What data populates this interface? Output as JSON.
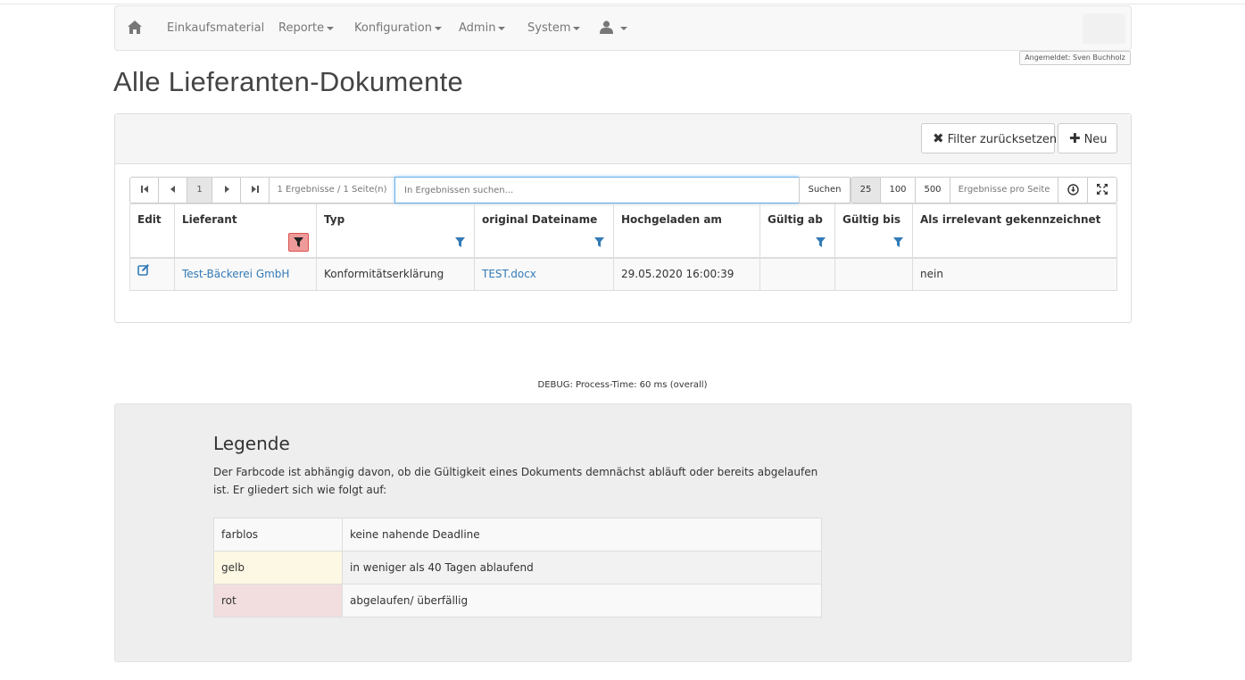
{
  "navbar": {
    "items": [
      {
        "label": "Einkaufsmaterial"
      },
      {
        "label": "Reporte"
      },
      {
        "label": "Konfiguration"
      },
      {
        "label": "Admin"
      },
      {
        "label": "System"
      }
    ]
  },
  "login_badge": "Angemeldet: Sven Buchholz",
  "page_title": "Alle Lieferanten-Dokumente",
  "actions": {
    "reset_filter": "Filter zurücksetzen",
    "new": "Neu"
  },
  "toolbar": {
    "current_page": "1",
    "results_info": "1 Ergebnisse / 1 Seite(n)",
    "search_placeholder": "In Ergebnissen suchen...",
    "search_label": "Suchen",
    "page_sizes": [
      "25",
      "100",
      "500"
    ],
    "page_size_selected": "25",
    "page_size_label": "Ergebnisse pro Seite"
  },
  "table": {
    "columns": [
      "Edit",
      "Lieferant",
      "Typ",
      "original Dateiname",
      "Hochgeladen am",
      "Gültig ab",
      "Gültig bis",
      "Als irrelevant gekennzeichnet"
    ],
    "rows": [
      {
        "supplier": "Test-Bäckerei GmbH",
        "type": "Konformitätserklärung",
        "filename": "TEST.docx",
        "uploaded": "29.05.2020 16:00:39",
        "valid_from": "",
        "valid_to": "",
        "irrelevant": "nein"
      }
    ]
  },
  "debug": "DEBUG: Process-Time: 60 ms (overall)",
  "legend": {
    "title": "Legende",
    "text": "Der Farbcode ist abhängig davon, ob die Gültigkeit eines Dokuments demnächst abläuft oder bereits abgelaufen ist. Er gliedert sich wie folgt auf:",
    "rows": [
      {
        "color": "farblos",
        "meaning": "keine nahende Deadline"
      },
      {
        "color": "gelb",
        "meaning": "in weniger als 40 Tagen ablaufend"
      },
      {
        "color": "rot",
        "meaning": "abgelaufen/ überfällig"
      }
    ]
  },
  "colors": {
    "link": "#337ab7",
    "filter_icon": "#337ab7",
    "filter_active_bg": "#ef9a9a",
    "legend_yellow": "#fcf8e3",
    "legend_red": "#f2dede"
  }
}
